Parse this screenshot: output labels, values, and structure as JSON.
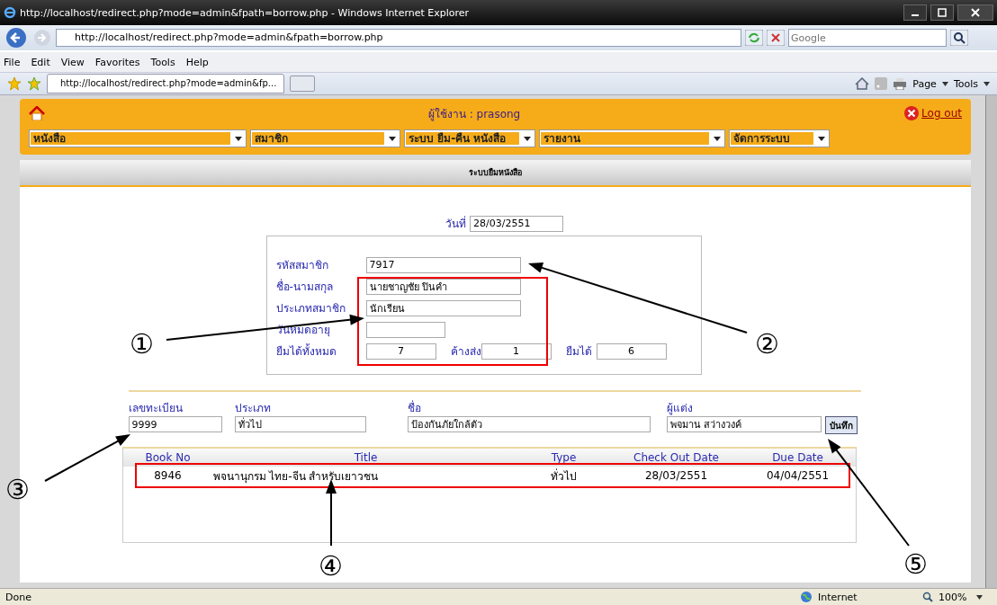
{
  "window": {
    "title": "http://localhost/redirect.php?mode=admin&fpath=borrow.php - Windows Internet Explorer"
  },
  "address_bar": {
    "url": "http://localhost/redirect.php?mode=admin&fpath=borrow.php"
  },
  "search": {
    "placeholder": "Google"
  },
  "menu": [
    "File",
    "Edit",
    "View",
    "Favorites",
    "Tools",
    "Help"
  ],
  "tab": {
    "title": "http://localhost/redirect.php?mode=admin&fp..."
  },
  "toolbar": [
    "Page",
    "Tools"
  ],
  "app": {
    "user_label": "ผู้ใช้งาน : prasong",
    "logout": "Log out",
    "nav_selects": [
      {
        "value": "หนังสือ"
      },
      {
        "value": "สมาชิก"
      },
      {
        "value": "ระบบ ยืม-คืน หนังสือ"
      },
      {
        "value": "รายงาน"
      },
      {
        "value": "จัดการระบบ"
      }
    ],
    "section_title": "ระบบยืมหนังสือ",
    "date": {
      "label": "วันที่",
      "value": "28/03/2551"
    },
    "member_fields": [
      {
        "label": "รหัสสมาชิก",
        "value": "7917"
      },
      {
        "label": "ชื่อ-นามสกุล",
        "value": "นายชาญชัย ปินคำ"
      },
      {
        "label": "ประเภทสมาชิก",
        "value": "นักเรียน"
      },
      {
        "label": "วันหมดอายุ"
      }
    ],
    "counts": [
      {
        "label": "ยืมได้ทั้งหมด",
        "value": "7"
      },
      {
        "label": "ค้างส่ง",
        "value": "1"
      },
      {
        "label": "ยืมได้",
        "value": "6"
      }
    ],
    "book_fields": [
      {
        "label": "เลขทะเบียน",
        "value": "9999"
      },
      {
        "label": "ประเภท",
        "value": "ทั่วไป"
      },
      {
        "label": "ชื่อ",
        "value": "ป้องกันภัยใกล้ตัว"
      },
      {
        "label": "ผู้แต่ง",
        "value": "พจมาน สว่างวงค์"
      }
    ],
    "save_button": "บันทึก",
    "table": {
      "columns": [
        "Book No",
        "Title",
        "Type",
        "Check Out Date",
        "Due Date"
      ],
      "rows": [
        [
          "8946",
          "พจนานุกรม ไทย-จีน สำหรับเยาวชน",
          "ทั่วไป",
          "28/03/2551",
          "04/04/2551"
        ]
      ]
    }
  },
  "status_bar": {
    "text": "Done",
    "zone": "Internet",
    "zoom": "100%"
  },
  "annotations": [
    {
      "label": "①"
    },
    {
      "label": "②"
    },
    {
      "label": "③"
    },
    {
      "label": "④"
    },
    {
      "label": "⑤"
    }
  ]
}
